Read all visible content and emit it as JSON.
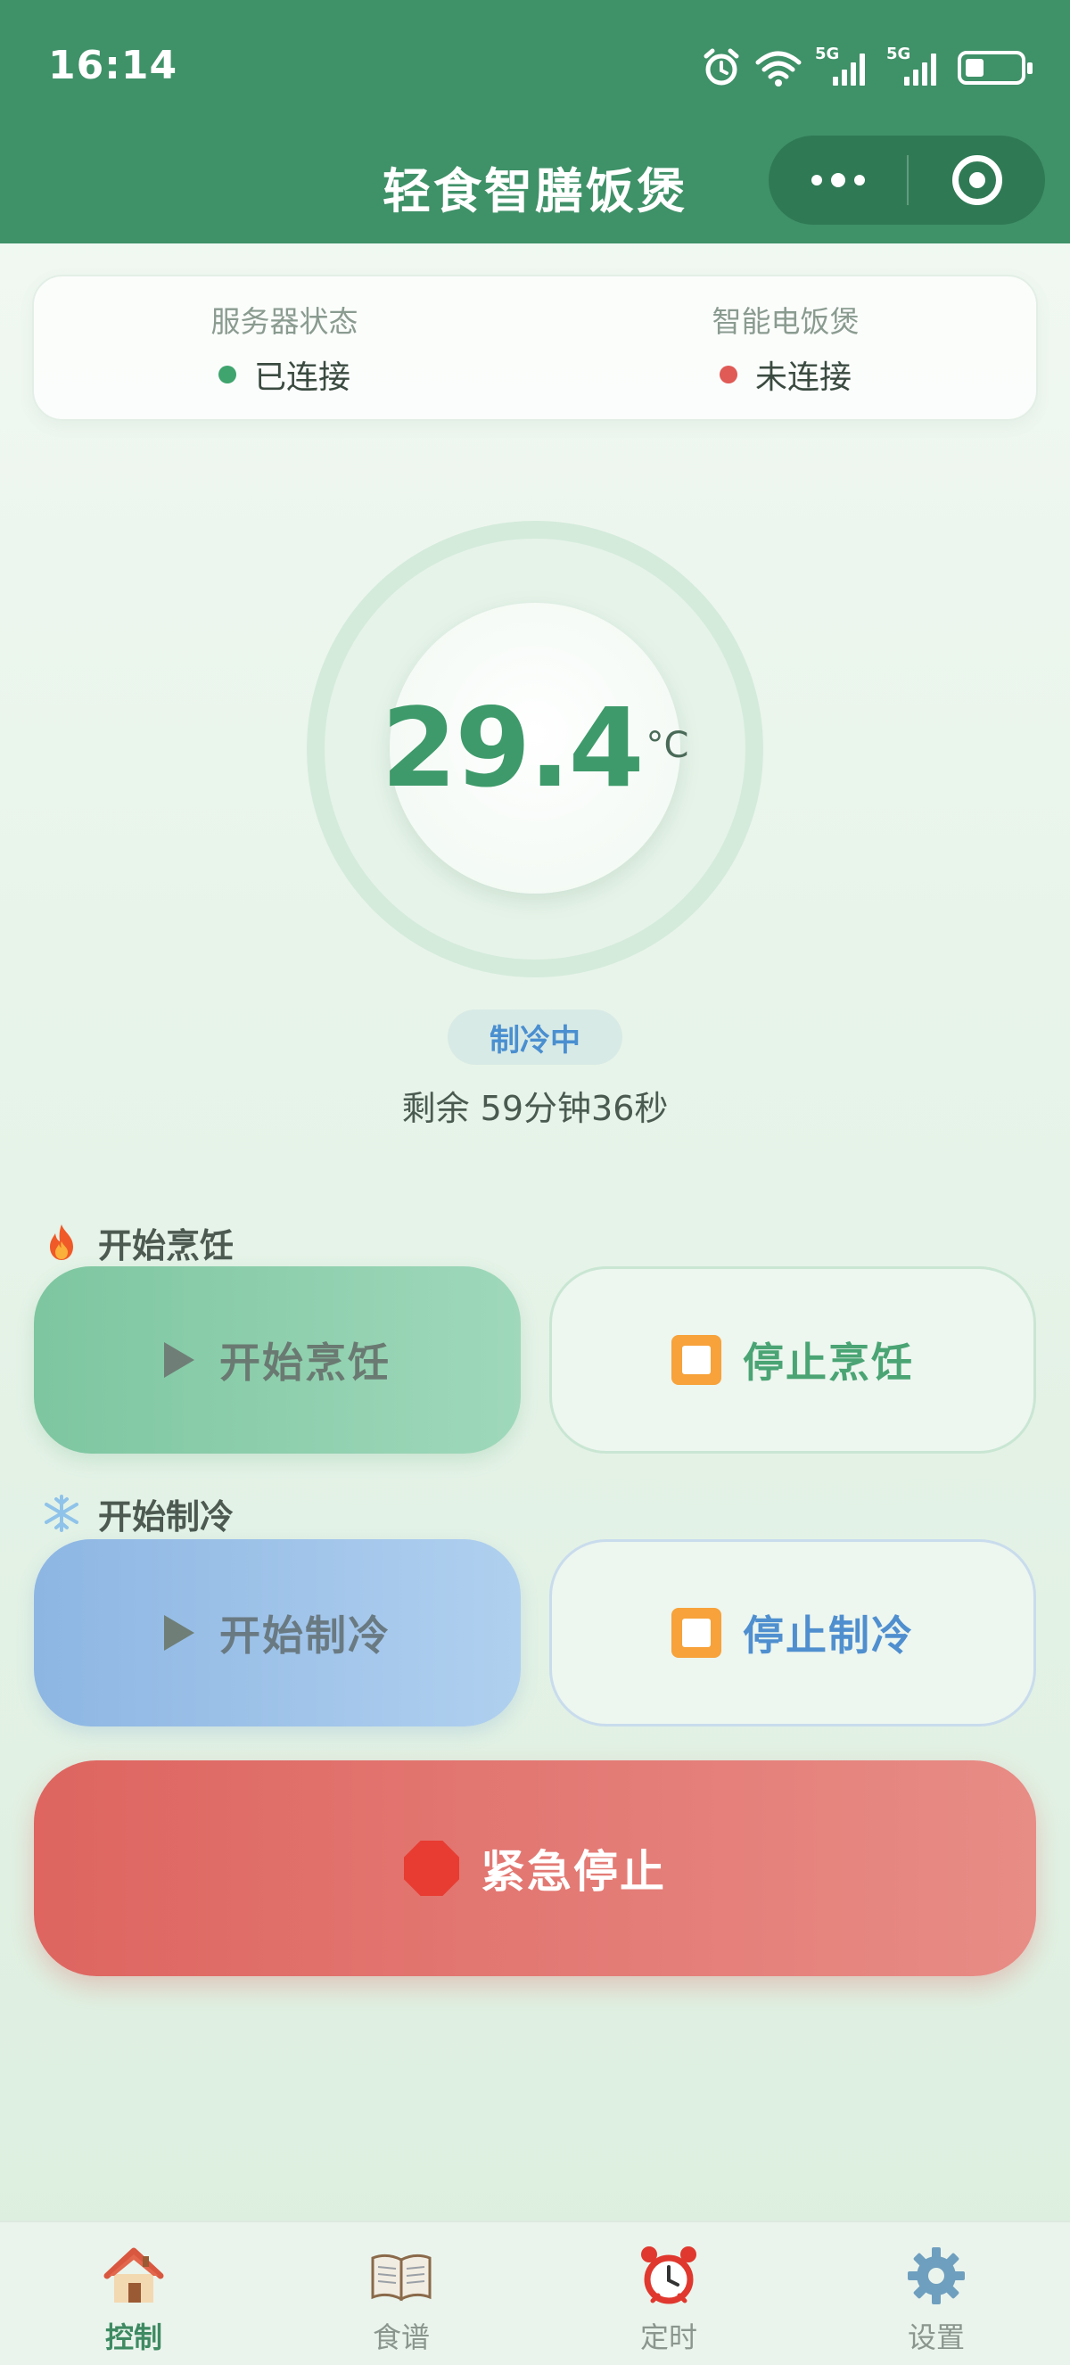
{
  "status_bar": {
    "time": "16:14",
    "signal_label_1": "5G",
    "signal_label_2": "5G"
  },
  "nav": {
    "title": "轻食智膳饭煲",
    "icons": [
      "more-dots-icon",
      "target-icon"
    ]
  },
  "connection": {
    "server_label": "服务器状态",
    "server_status": "已连接",
    "server_color": "#3fa46e",
    "cooker_label": "智能电饭煲",
    "cooker_status": "未连接",
    "cooker_color": "#e05a56"
  },
  "temperature": {
    "value": "29.4",
    "unit": "°C"
  },
  "mode": {
    "label": "制冷中",
    "remaining": "剩余 59分钟36秒"
  },
  "cooking": {
    "section_title": "开始烹饪",
    "section_icon": "fire-icon",
    "start_label": "开始烹饪",
    "stop_label": "停止烹饪"
  },
  "cooling": {
    "section_title": "开始制冷",
    "section_icon": "snowflake-icon",
    "start_label": "开始制冷",
    "stop_label": "停止制冷"
  },
  "emergency": {
    "label": "紧急停止",
    "icon": "stop-sign-icon"
  },
  "tabbar": {
    "tabs": [
      {
        "label": "控制",
        "icon": "house-icon",
        "active": true
      },
      {
        "label": "食谱",
        "icon": "book-icon",
        "active": false
      },
      {
        "label": "定时",
        "icon": "alarm-clock-icon",
        "active": false
      },
      {
        "label": "设置",
        "icon": "gear-icon",
        "active": false
      }
    ]
  },
  "colors": {
    "header": "#3f9168",
    "accent_green": "#3e9a6a",
    "accent_blue": "#4a8fd0",
    "emergency_red": "#de6560"
  }
}
